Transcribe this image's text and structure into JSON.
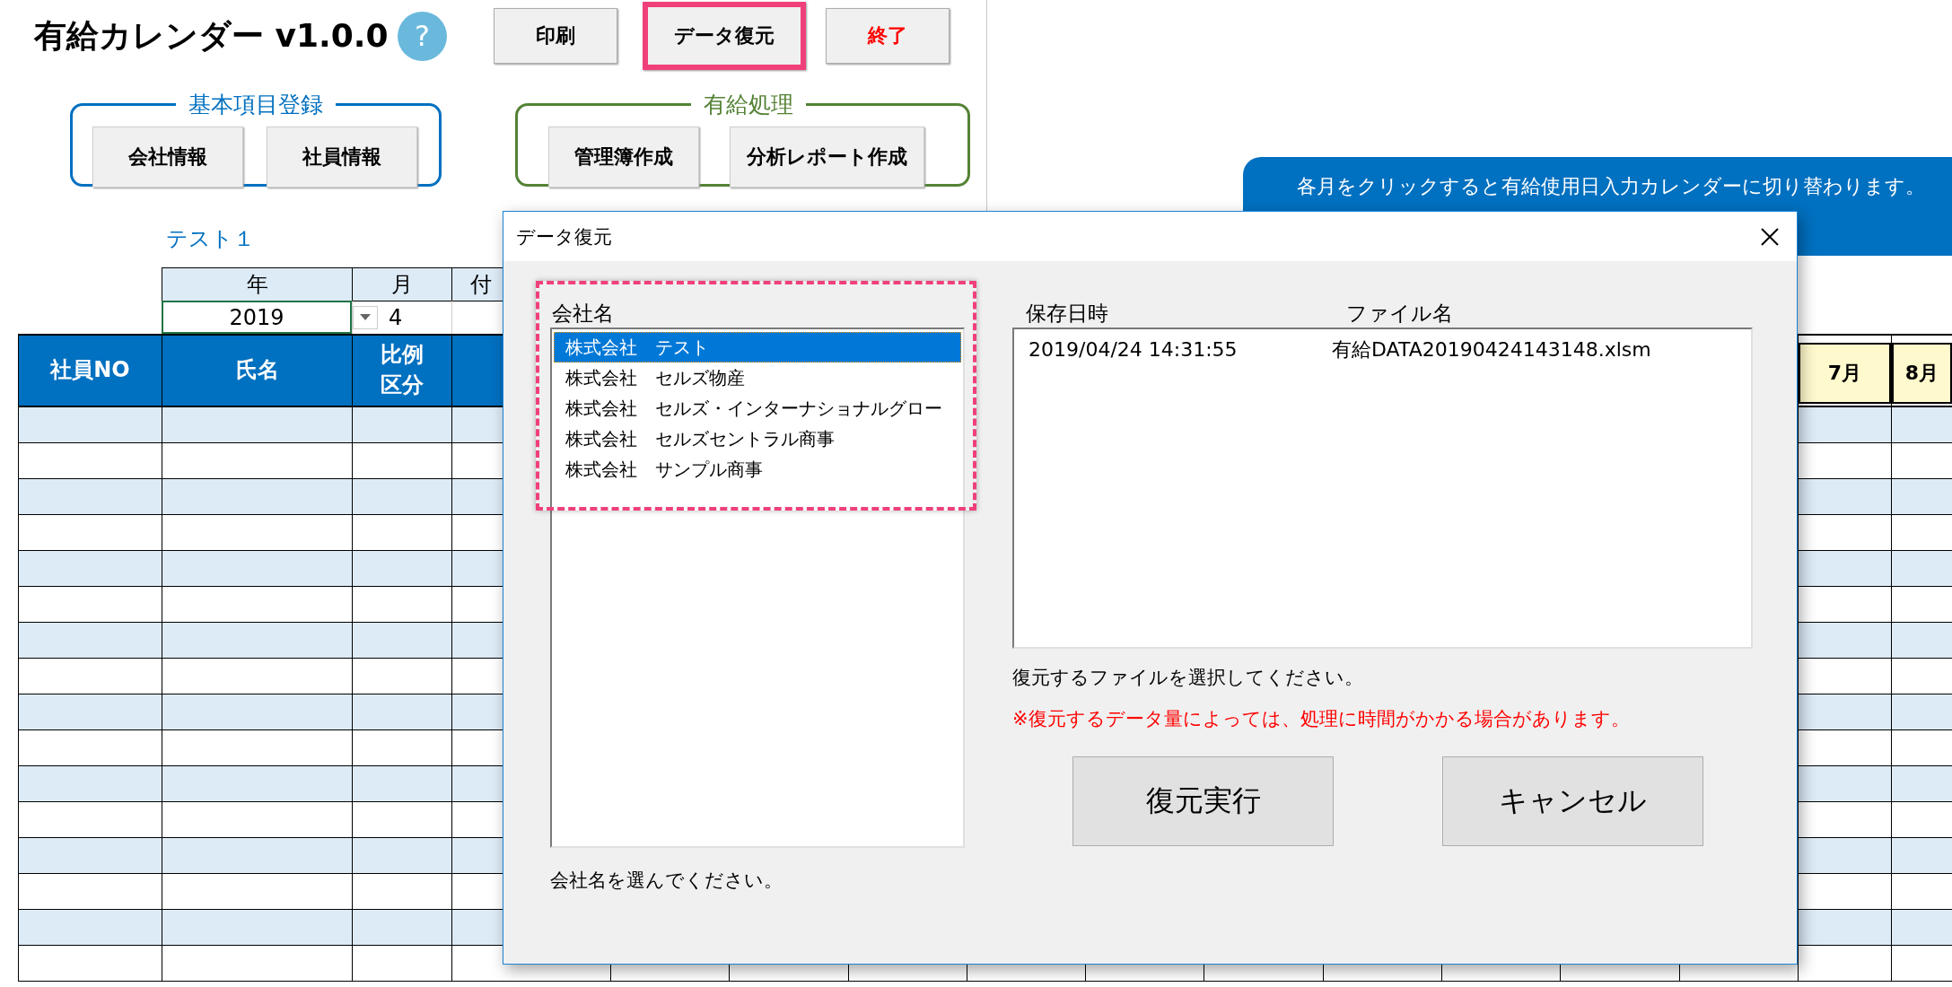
{
  "app": {
    "title": "有給カレンダー v1.0.0",
    "help": "?"
  },
  "toolbar": [
    {
      "label": "印刷",
      "kind": "normal",
      "highlighted": false
    },
    {
      "label": "データ復元",
      "kind": "normal",
      "highlighted": true
    },
    {
      "label": "終了",
      "kind": "danger",
      "highlighted": false
    }
  ],
  "groups": [
    {
      "title": "基本項目登録",
      "color": "#0070c0",
      "buttons": [
        "会社情報",
        "社員情報"
      ]
    },
    {
      "title": "有給処理",
      "color": "#548235",
      "buttons": [
        "管理簿作成",
        "分析レポート作成"
      ]
    }
  ],
  "banner": "各月をクリックすると有給使用日入力カレンダーに切り替わります。",
  "sheet_name": "テスト１",
  "period": {
    "headers": [
      "年",
      "月",
      "付"
    ],
    "values": [
      "2019",
      "4"
    ]
  },
  "table": {
    "columns": [
      "社員NO",
      "氏名",
      "比例区分"
    ],
    "months": [
      "7月",
      "8月"
    ]
  },
  "dialog": {
    "title": "データ復元",
    "highlight": true,
    "company_label": "会社名",
    "companies": [
      {
        "name": "株式会社　テスト",
        "selected": true
      },
      {
        "name": "株式会社　セルズ物産",
        "selected": false
      },
      {
        "name": "株式会社　セルズ・インターナショナルグロー",
        "selected": false
      },
      {
        "name": "株式会社　セルズセントラル商事",
        "selected": false
      },
      {
        "name": "株式会社　サンプル商事",
        "selected": false
      }
    ],
    "company_hint": "会社名を選んでください。",
    "file_columns": [
      "保存日時",
      "ファイル名"
    ],
    "files": [
      {
        "saved": "2019/04/24 14:31:55",
        "file": "有給DATA20190424143148.xlsm",
        "selected": false
      }
    ],
    "file_hint": "復元するファイルを選択してください。",
    "warning": "※復元するデータ量によっては、処理に時間がかかる場合があります。",
    "buttons": [
      "復元実行",
      "キャンセル"
    ]
  }
}
